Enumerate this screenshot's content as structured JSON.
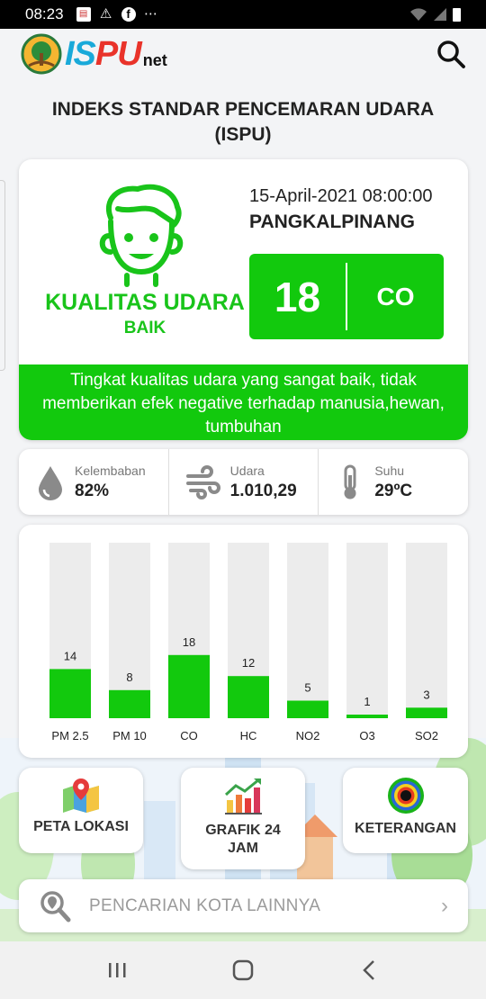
{
  "status_bar": {
    "time": "08:23"
  },
  "header": {
    "logo_text_1": "IS",
    "logo_text_2": "PU",
    "logo_text_3": "net"
  },
  "page_title": "INDEKS STANDAR PENCEMARAN UDARA (ISPU)",
  "air_quality": {
    "label": "KUALITAS UDARA",
    "status": "BAIK",
    "datetime": "15-April-2021 08:00:00",
    "city": "PANGKALPINANG",
    "index_value": "18",
    "index_parameter": "CO",
    "description": "Tingkat kualitas udara yang sangat baik, tidak memberikan efek negative terhadap manusia,hewan, tumbuhan",
    "color": "#12c90d"
  },
  "weather": [
    {
      "label": "Kelembaban",
      "value": "82%",
      "icon": "water-drop-icon"
    },
    {
      "label": "Udara",
      "value": "1.010,29",
      "icon": "wind-icon"
    },
    {
      "label": "Suhu",
      "value": "29ºC",
      "icon": "thermometer-icon"
    }
  ],
  "chart_data": {
    "type": "bar",
    "categories": [
      "PM 2.5",
      "PM 10",
      "CO",
      "HC",
      "NO2",
      "O3",
      "SO2"
    ],
    "values": [
      14,
      8,
      18,
      12,
      5,
      1,
      3
    ],
    "ylim": [
      0,
      50
    ],
    "bar_color": "#12c90d",
    "track_color": "#ececec"
  },
  "nav_buttons": [
    {
      "label": "PETA LOKASI",
      "icon": "map-location-icon"
    },
    {
      "label": "GRAFIK 24 JAM",
      "icon": "bar-graph-icon"
    },
    {
      "label": "KETERANGAN",
      "icon": "color-rings-icon"
    }
  ],
  "city_search": {
    "placeholder": "PENCARIAN KOTA LAINNYA"
  }
}
